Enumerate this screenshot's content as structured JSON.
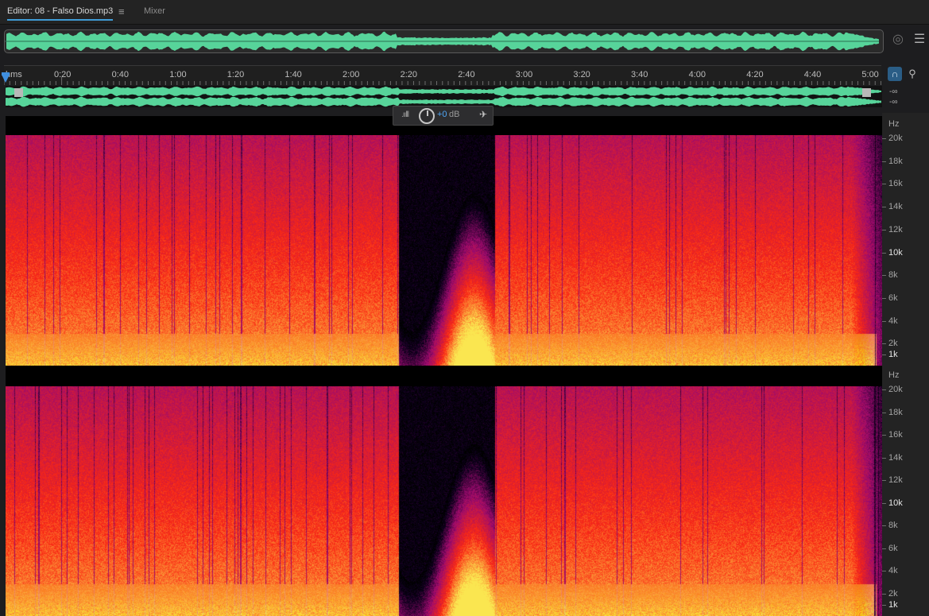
{
  "tabs": {
    "editor_label": "Editor: 08 - Falso Dios.mp3",
    "editor_menu_icon": "hamburger-icon",
    "mixer_label": "Mixer"
  },
  "timeline": {
    "format_label": "hms",
    "ticks": [
      "0:20",
      "0:40",
      "1:00",
      "1:20",
      "1:40",
      "2:00",
      "2:20",
      "2:40",
      "3:00",
      "3:20",
      "3:40",
      "4:00",
      "4:20",
      "4:40",
      "5:00"
    ]
  },
  "levels": {
    "left_db": "-∞",
    "right_db": "-∞"
  },
  "hud": {
    "gain_value": "+0",
    "gain_unit": "dB"
  },
  "frequency_axis": {
    "unit": "Hz",
    "labels": [
      "20k",
      "18k",
      "16k",
      "14k",
      "12k",
      "10k",
      "8k",
      "6k",
      "4k",
      "2k",
      "1k"
    ]
  },
  "colors": {
    "waveform": "#57d49a",
    "accent": "#3f8fe0",
    "spectro_hot": "#ffd35a",
    "spectro_mid": "#e0201a",
    "spectro_low": "#6e1470"
  }
}
